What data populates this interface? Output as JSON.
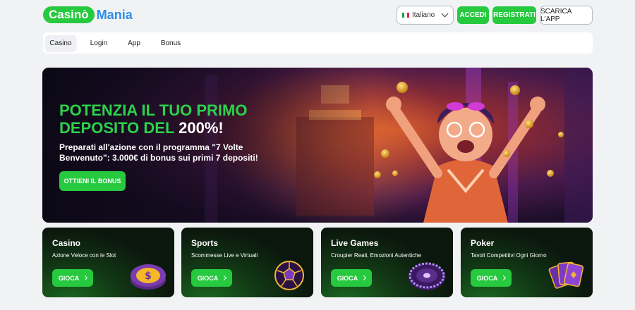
{
  "header": {
    "logo_part1": "Casinò",
    "logo_part2": "Mania",
    "language": "Italiano",
    "login_label": "ACCEDI",
    "register_label": "REGISTRATI",
    "download_label": "SCARICA L'APP"
  },
  "nav": {
    "items": [
      {
        "label": "Casino",
        "active": true
      },
      {
        "label": "Login"
      },
      {
        "label": "App"
      },
      {
        "label": "Bonus"
      }
    ]
  },
  "hero": {
    "title_line1": "POTENZIA IL TUO PRIMO",
    "title_line2_green": "DEPOSITO DEL",
    "title_line2_white": "200%!",
    "subtitle": "Preparati all'azione con il programma \"7 Volte Benvenuto\": 3.000€ di bonus sui primi 7 depositi!",
    "cta": "OTTIENI IL BONUS"
  },
  "cards": [
    {
      "title": "Casino",
      "subtitle": "Azione Veloce con le Slot",
      "button": "GIOCA",
      "icon": "dollar-chip-icon"
    },
    {
      "title": "Sports",
      "subtitle": "Scommesse Live e Virtuali",
      "button": "GIOCA",
      "icon": "soccer-ball-icon"
    },
    {
      "title": "Live Games",
      "subtitle": "Croupier Reali, Emozioni Autentiche",
      "button": "GIOCA",
      "icon": "roulette-wheel-icon"
    },
    {
      "title": "Poker",
      "subtitle": "Tavoli Competitivi Ogni Giorno",
      "button": "GIOCA",
      "icon": "playing-cards-icon"
    }
  ],
  "colors": {
    "accent_green": "#27c93f",
    "logo_blue": "#2a8ff0",
    "page_background": "#f1f2f4"
  }
}
